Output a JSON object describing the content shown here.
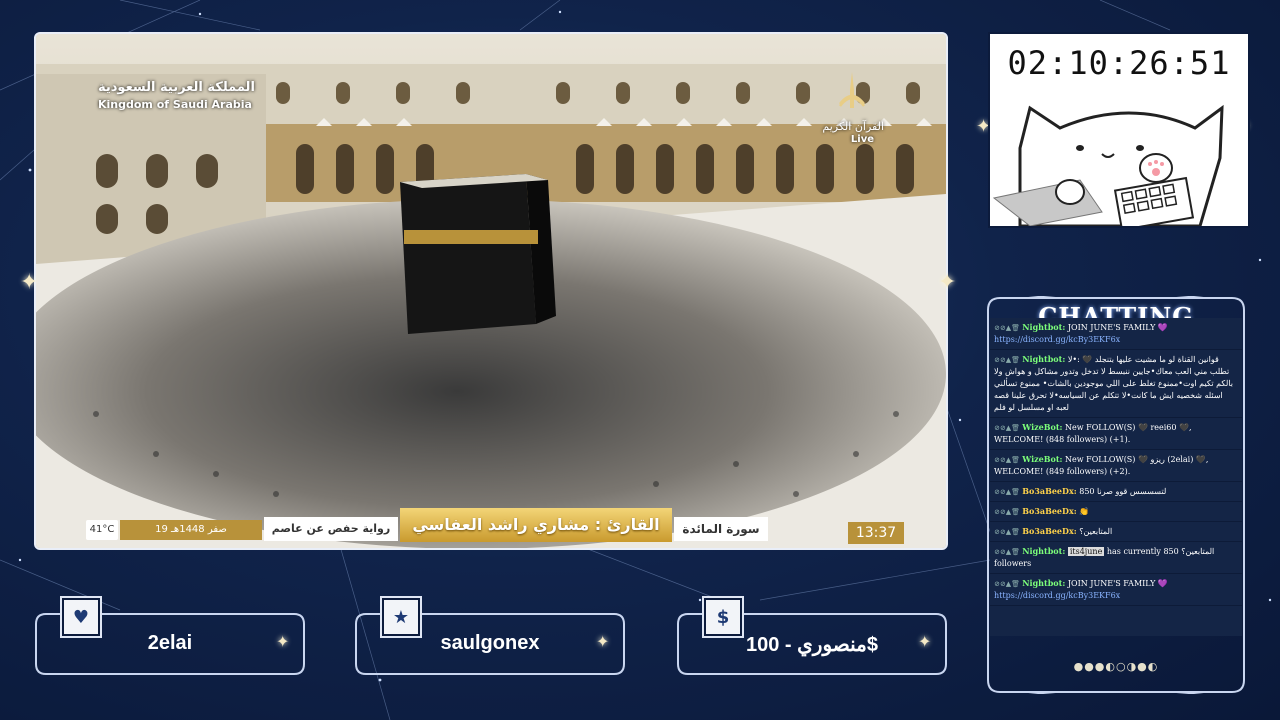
{
  "video": {
    "country_ar": "المملكة العربية السعودية",
    "country_en": "Kingdom of Saudi Arabia",
    "channel": "القرآن الكريم",
    "live": "Live",
    "temperature": "41°C",
    "hijri_date": "19 صفر 1448هـ",
    "riwaya": "رواية حفص عن عاصم",
    "reciter": "القارئ : مشاري راشد العفاسي",
    "surah": "سورة المائدة",
    "clock": "13:37"
  },
  "timer": {
    "value": "02:10:26:51"
  },
  "chat": {
    "title": "CHATTING",
    "messages": [
      {
        "user": "Nightbot:",
        "text": "JOIN JUNE'S FAMILY 💜",
        "link": "https://discord.gg/kcBy3EKF6x",
        "color": "#7dff7a"
      },
      {
        "user": "Nightbot:",
        "text": "قوانين القناة لو ما مشيت عليها بتنجلد 🖤 :•لا تطلب مني العب معاك•جايين ننبسط لا تدخل وتدور مشاكل و هواش ولا بالكم تكيم اوت•ممنوع تغلط على اللي موجودين بالشات• ممنوع تسألني اسئله شخصيه ايش ما كانت•لا تتكلم عن السياسه•لا تحرق علينا قصه لعبه او مسلسل لو فلم",
        "link": "",
        "color": "#7dff7a"
      },
      {
        "user": "WizeBot:",
        "text": "New FOLLOW(S) 🖤 reei60 🖤, WELCOME! (848 followers) (+1).",
        "link": "",
        "color": "#7dff7a"
      },
      {
        "user": "WizeBot:",
        "text": "New FOLLOW(S) 🖤 ريزو (2elai) 🖤, WELCOME! (849 followers) (+2).",
        "link": "",
        "color": "#7dff7a"
      },
      {
        "user": "Bo3aBeeDx:",
        "text": "لتسسسس قوو صرنا 850",
        "link": "",
        "color": "#ffd24a"
      },
      {
        "user": "Bo3aBeeDx:",
        "text": "👏",
        "link": "",
        "color": "#ffd24a"
      },
      {
        "user": "Bo3aBeeDx:",
        "text": "المتابعين؟",
        "link": "",
        "color": "#ffd24a"
      },
      {
        "user": "Nightbot:",
        "text": "has currently 850 المتابعين؟ followers",
        "tag": "its4june",
        "link": "",
        "color": "#7dff7a"
      },
      {
        "user": "Nightbot:",
        "text": "JOIN JUNE'S FAMILY 💜",
        "link": "https://discord.gg/kcBy3EKF6x",
        "color": "#7dff7a"
      }
    ],
    "moons": "●●●◐○◑●◐"
  },
  "labels": {
    "follower": {
      "icon": "heart-icon",
      "text": "2elai"
    },
    "subscriber": {
      "icon": "star-icon",
      "text": "saulgonex"
    },
    "donation": {
      "icon": "dollar-icon",
      "icon_glyph": "$",
      "text": "منصوري - 100$"
    }
  }
}
